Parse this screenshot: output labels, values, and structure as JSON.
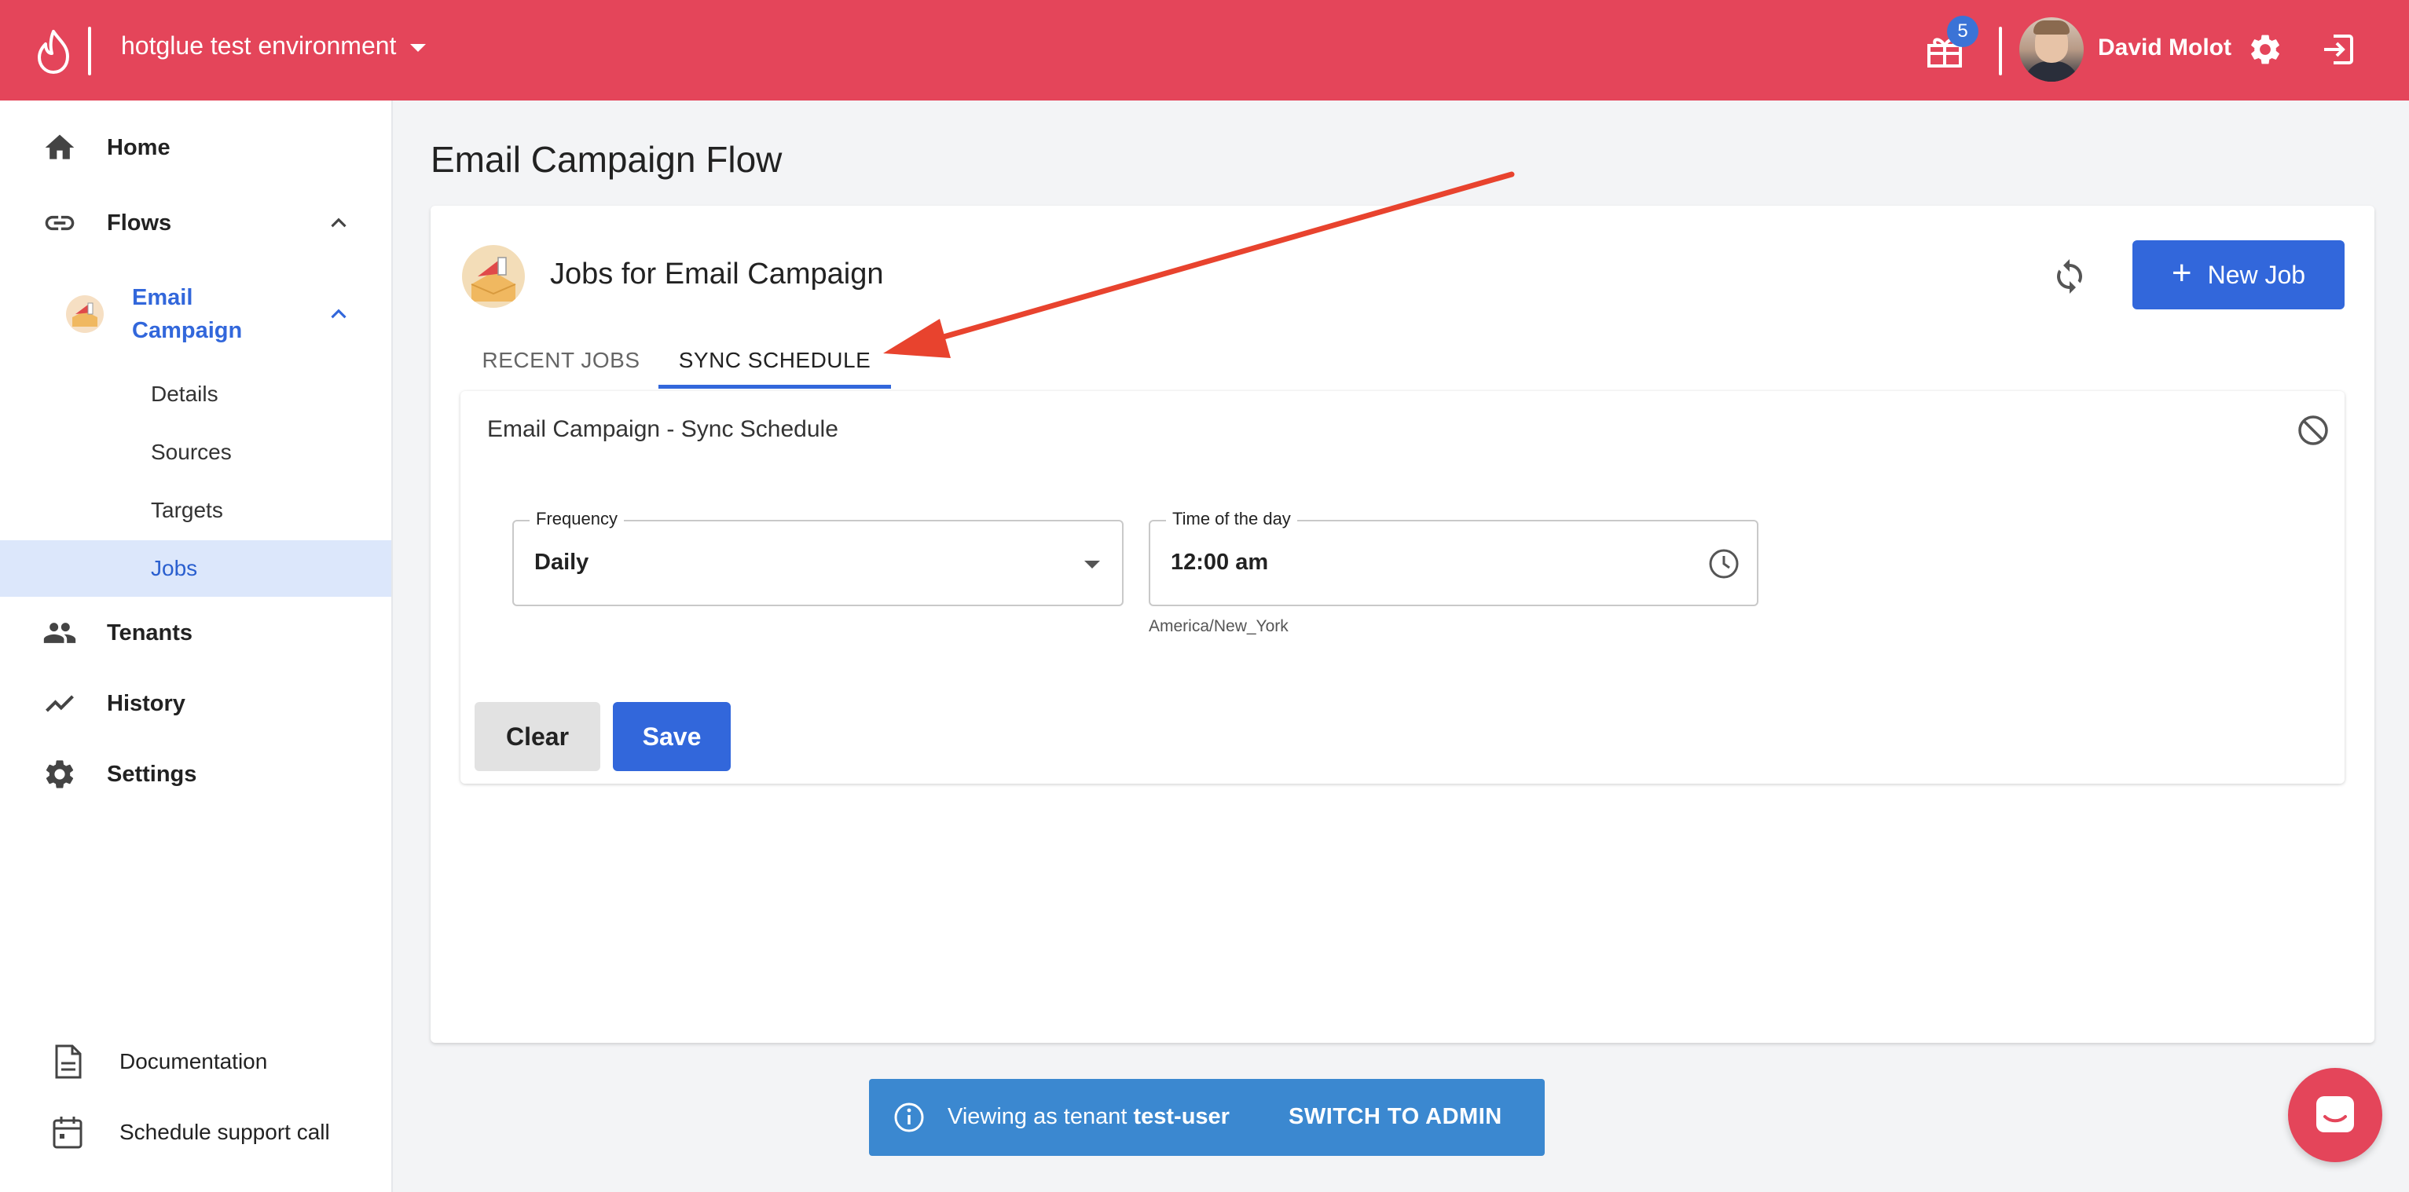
{
  "header": {
    "environment": "hotglue test environment",
    "notification_count": "5",
    "user_name": "David Molot"
  },
  "sidebar": {
    "items": [
      {
        "label": "Home",
        "icon": "home-icon"
      },
      {
        "label": "Flows",
        "icon": "link-icon"
      },
      {
        "label": "Tenants",
        "icon": "people-icon"
      },
      {
        "label": "History",
        "icon": "trend-icon"
      },
      {
        "label": "Settings",
        "icon": "gear-icon"
      }
    ],
    "flow": {
      "label_line1": "Email",
      "label_line2": "Campaign"
    },
    "sub_items": [
      {
        "label": "Details"
      },
      {
        "label": "Sources"
      },
      {
        "label": "Targets"
      },
      {
        "label": "Jobs",
        "active": true
      }
    ],
    "bottom": [
      {
        "label": "Documentation",
        "icon": "document-icon"
      },
      {
        "label": "Schedule support call",
        "icon": "calendar-icon"
      }
    ]
  },
  "main": {
    "page_title": "Email Campaign Flow",
    "card_title": "Jobs for Email Campaign",
    "new_job_label": "New Job",
    "tabs": [
      {
        "label": "RECENT JOBS",
        "active": false
      },
      {
        "label": "SYNC SCHEDULE",
        "active": true
      }
    ],
    "schedule": {
      "title": "Email Campaign - Sync Schedule",
      "frequency_label": "Frequency",
      "frequency_value": "Daily",
      "time_label": "Time of the day",
      "time_value": "12:00 am",
      "timezone": "America/New_York",
      "clear_label": "Clear",
      "save_label": "Save"
    }
  },
  "banner": {
    "prefix": "Viewing as tenant ",
    "tenant": "test-user",
    "switch_label": "SWITCH TO ADMIN"
  },
  "colors": {
    "brand": "#e4455a",
    "primary": "#3267db",
    "banner": "#3b88d0",
    "annotation": "#e8432e"
  }
}
